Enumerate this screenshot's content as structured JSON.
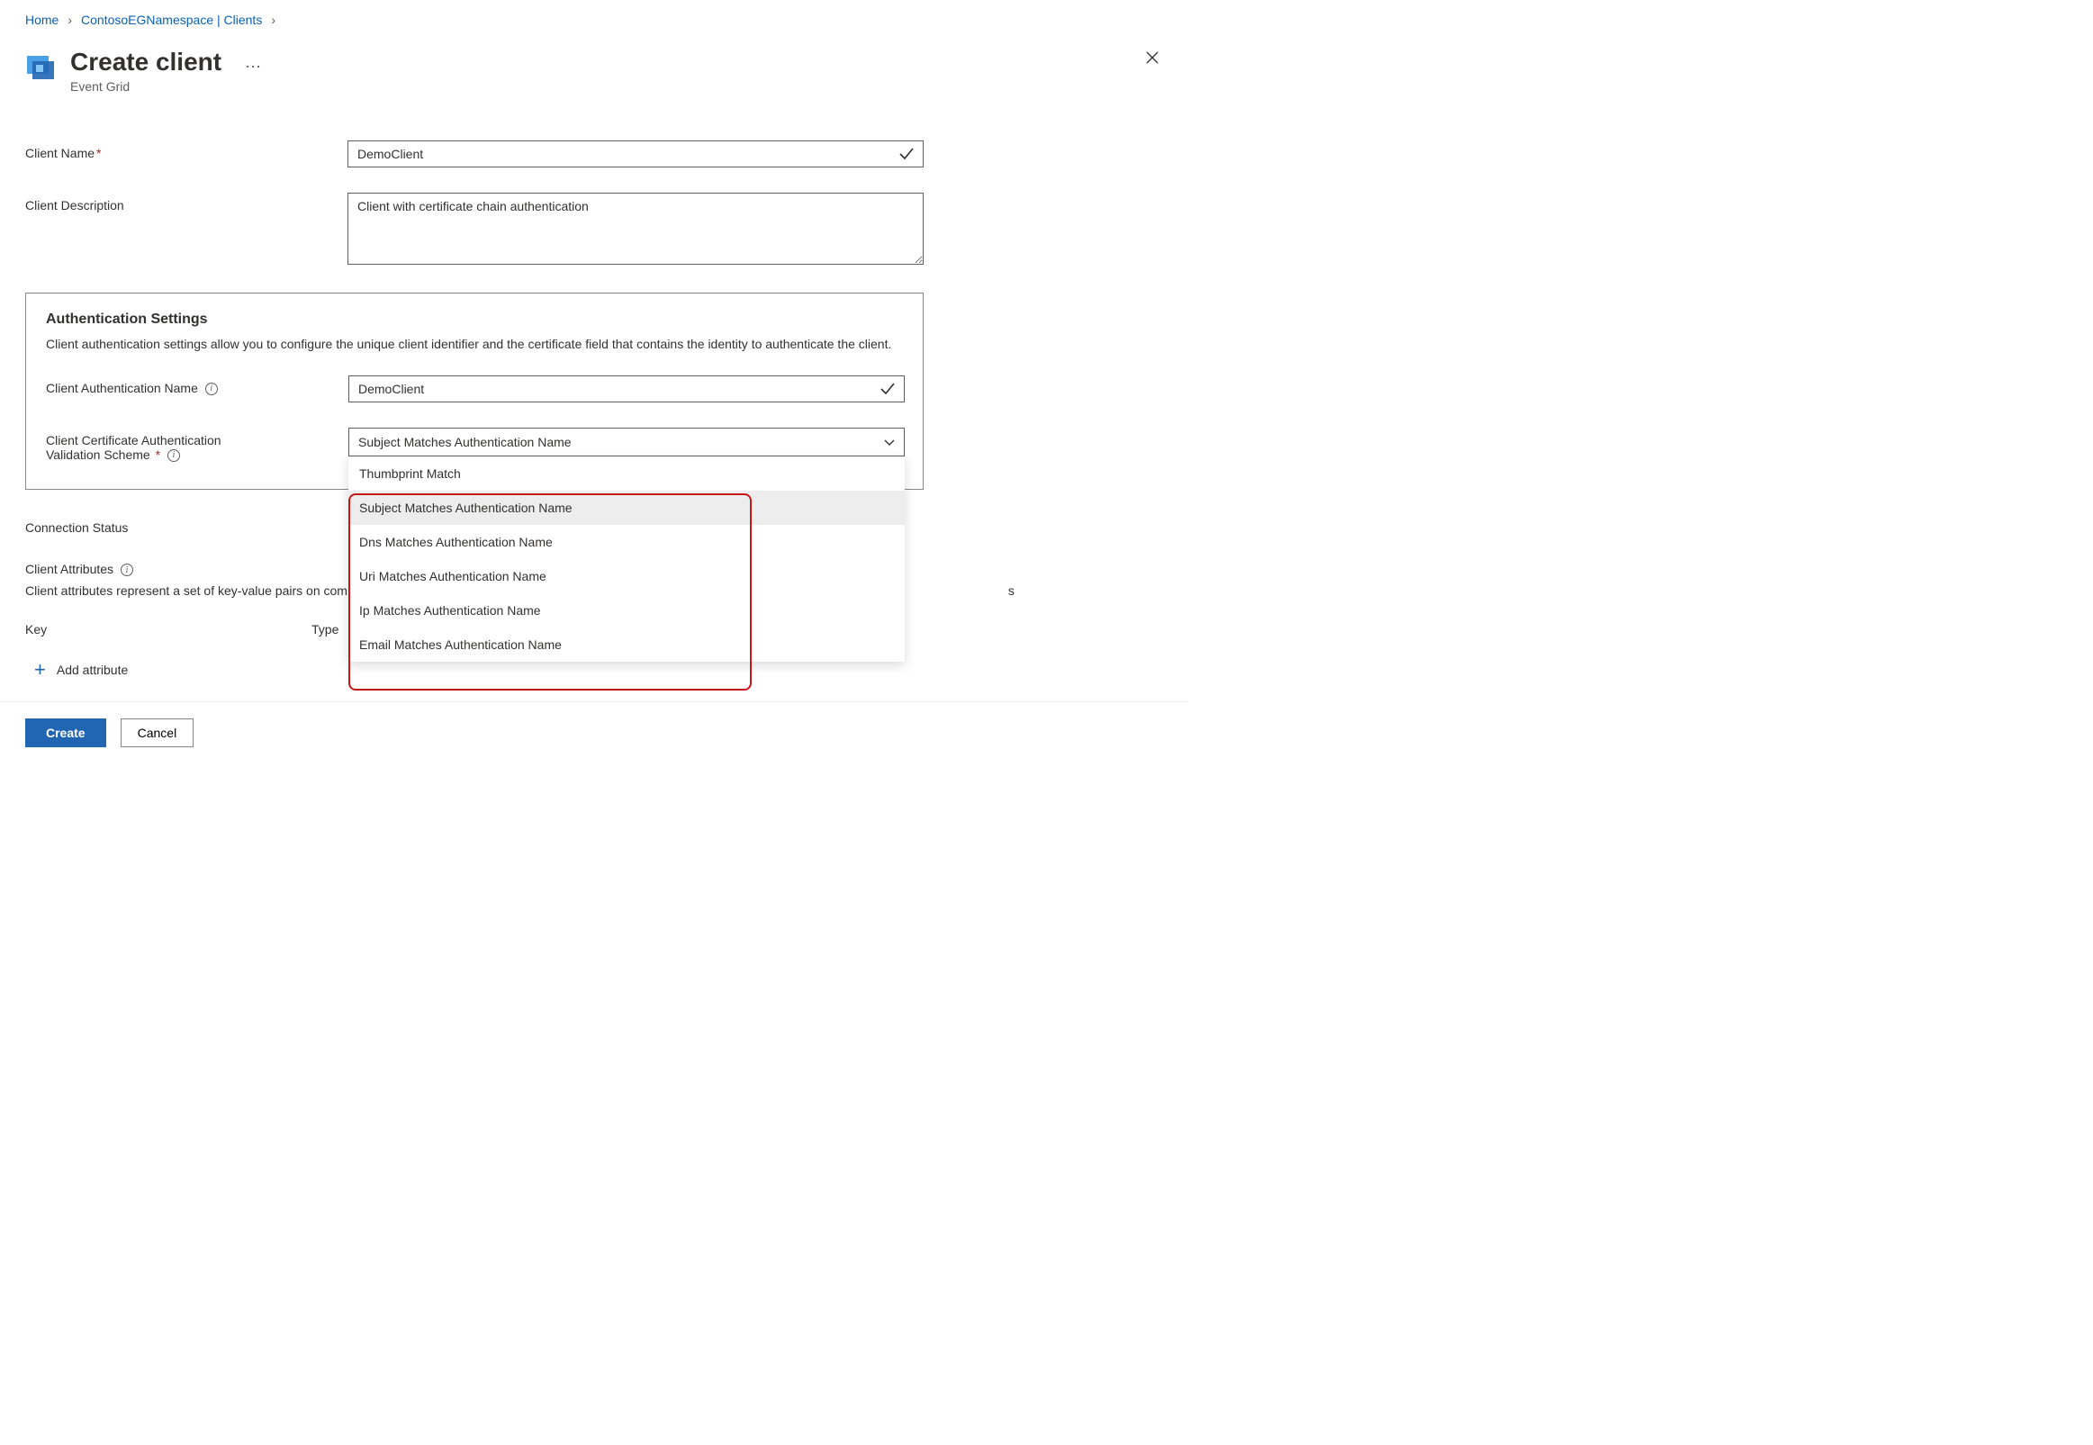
{
  "breadcrumb": {
    "home": "Home",
    "namespace": "ContosoEGNamespace | Clients"
  },
  "header": {
    "title": "Create client",
    "subtitle": "Event Grid"
  },
  "form": {
    "client_name_label": "Client Name",
    "client_name_value": "DemoClient",
    "client_desc_label": "Client Description",
    "client_desc_value": "Client with certificate chain authentication"
  },
  "auth": {
    "title": "Authentication Settings",
    "desc": "Client authentication settings allow you to configure the unique client identifier and the certificate field that contains the identity to authenticate the client.",
    "auth_name_label": "Client Authentication Name",
    "auth_name_value": "DemoClient",
    "scheme_label_line1": "Client Certificate Authentication",
    "scheme_label_line2": "Validation Scheme",
    "scheme_selected": "Subject Matches Authentication Name",
    "scheme_options": [
      "Thumbprint Match",
      "Subject Matches Authentication Name",
      "Dns Matches Authentication Name",
      "Uri Matches Authentication Name",
      "Ip Matches Authentication Name",
      "Email Matches Authentication Name"
    ]
  },
  "connection_status_label": "Connection Status",
  "attributes": {
    "title": "Client Attributes",
    "desc": "Client attributes represent a set of key-value pairs on common attribute values.",
    "key_header": "Key",
    "type_header": "Type",
    "add_label": "Add attribute"
  },
  "footer": {
    "create": "Create",
    "cancel": "Cancel"
  }
}
